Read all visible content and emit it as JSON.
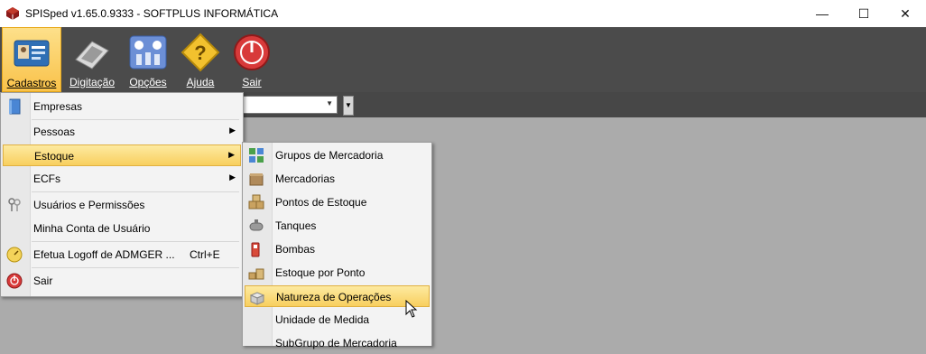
{
  "window": {
    "title": "SPISped v1.65.0.9333 - SOFTPLUS INFORMÁTICA",
    "minimize": "—",
    "maximize": "☐",
    "close": "✕"
  },
  "toolbar": {
    "buttons": [
      {
        "label": "Cadastros",
        "icon": "id-card-icon",
        "active": true
      },
      {
        "label": "Digitação",
        "icon": "keyboard-icon",
        "active": false
      },
      {
        "label": "Opções",
        "icon": "settings-panel-icon",
        "active": false
      },
      {
        "label": "Ajuda",
        "icon": "help-icon",
        "active": false
      },
      {
        "label": "Sair",
        "icon": "power-icon",
        "active": false
      }
    ]
  },
  "cadastros_menu": {
    "items": [
      {
        "label": "Empresas",
        "icon": "book-icon"
      },
      {
        "label": "Pessoas",
        "submenu": true
      },
      {
        "label": "Estoque",
        "submenu": true,
        "highlighted": true
      },
      {
        "label": "ECFs",
        "submenu": true
      },
      {
        "label": "Usuários e Permissões",
        "icon": "keys-icon"
      },
      {
        "label": "Minha Conta de Usuário"
      },
      {
        "label": "Efetua Logoff de ADMGER ...",
        "shortcut": "Ctrl+E",
        "icon": "clock-icon"
      },
      {
        "label": "Sair",
        "icon": "power-icon"
      }
    ]
  },
  "estoque_menu": {
    "items": [
      {
        "label": "Grupos de Mercadoria",
        "icon": "grid-icon"
      },
      {
        "label": "Mercadorias",
        "icon": "box-icon"
      },
      {
        "label": "Pontos de Estoque",
        "icon": "boxes-icon"
      },
      {
        "label": "Tanques",
        "icon": "tank-icon"
      },
      {
        "label": "Bombas",
        "icon": "fuel-pump-icon"
      },
      {
        "label": "Estoque por Ponto",
        "icon": "stock-icon"
      },
      {
        "label": "Natureza de Operações",
        "icon": "open-box-icon",
        "highlighted": true
      },
      {
        "label": "Unidade de Medida"
      },
      {
        "label": "SubGrupo de Mercadoria"
      }
    ]
  },
  "colors": {
    "toolbar_bg": "#4b4b4b",
    "workspace_bg": "#ababab",
    "highlight": "#f8cf5e"
  }
}
